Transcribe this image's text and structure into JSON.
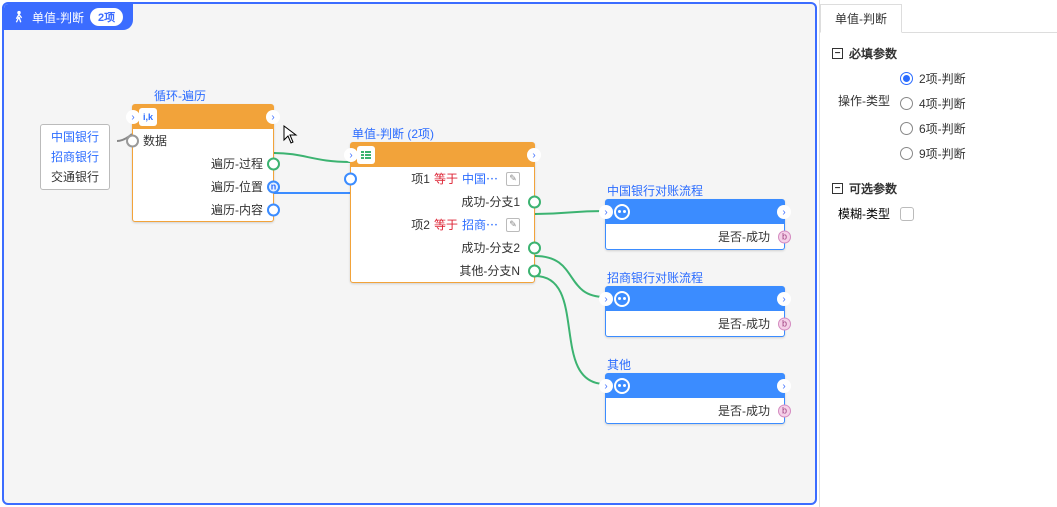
{
  "canvas": {
    "title": "单值-判断",
    "badge": "2项"
  },
  "listbox": {
    "items": [
      {
        "label": "中国银行",
        "style": "lnk"
      },
      {
        "label": "招商银行",
        "style": "lnk"
      },
      {
        "label": "交通银行",
        "style": "plain"
      }
    ]
  },
  "loop": {
    "label": "循环-遍历",
    "icon_text": "i,k",
    "rows": {
      "data": "数据",
      "process": "遍历-过程",
      "position": "遍历-位置",
      "content": "遍历-内容"
    },
    "position_badge": "n"
  },
  "judge": {
    "label": "单值-判断 (2项)",
    "rows": [
      {
        "k": "项1",
        "op": "等于",
        "val": "中国⋯",
        "kind": "item"
      },
      {
        "k": "",
        "op": "",
        "val": "成功-分支1",
        "kind": "branch"
      },
      {
        "k": "项2",
        "op": "等于",
        "val": "招商⋯",
        "kind": "item"
      },
      {
        "k": "",
        "op": "",
        "val": "成功-分支2",
        "kind": "branch"
      },
      {
        "k": "",
        "op": "",
        "val": "其他-分支N",
        "kind": "branch"
      }
    ]
  },
  "flows": [
    {
      "title": "中国银行对账流程",
      "row": "是否-成功",
      "badge": "b"
    },
    {
      "title": "招商银行对账流程",
      "row": "是否-成功",
      "badge": "b"
    },
    {
      "title": "其他",
      "row": "是否-成功",
      "badge": "b"
    }
  ],
  "panel": {
    "tab": "单值-判断",
    "group_required": "必填参数",
    "op_type_label": "操作-类型",
    "radios": [
      {
        "label": "2项-判断",
        "selected": true
      },
      {
        "label": "4项-判断",
        "selected": false
      },
      {
        "label": "6项-判断",
        "selected": false
      },
      {
        "label": "9项-判断",
        "selected": false
      }
    ],
    "group_optional": "可选参数",
    "fuzzy_label": "模糊-类型"
  }
}
